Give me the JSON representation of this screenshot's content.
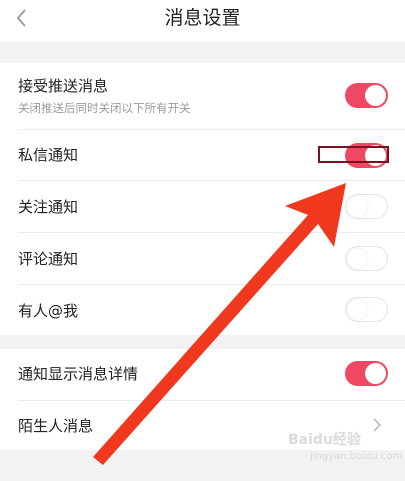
{
  "header": {
    "title": "消息设置",
    "back_icon": "chevron-left-icon"
  },
  "settings": {
    "push": {
      "label": "接受推送消息",
      "description": "关闭推送后同时关闭以下所有开关",
      "enabled": true
    },
    "private_message": {
      "label": "私信通知",
      "enabled": true
    },
    "follow": {
      "label": "关注通知",
      "enabled": false
    },
    "comment": {
      "label": "评论通知",
      "enabled": false
    },
    "mention": {
      "label": "有人@我",
      "enabled": false
    },
    "show_details": {
      "label": "通知显示消息详情",
      "enabled": true
    },
    "stranger": {
      "label": "陌生人消息",
      "icon": "chevron-right-icon"
    }
  },
  "overlay": {
    "arrow_color": "#f0381f",
    "highlight_color": "#7a1220"
  },
  "colors": {
    "toggle_on": "#ee4863",
    "background": "#f2f2f4"
  },
  "watermark": {
    "logo": "Baidu经验",
    "url": "jingyan.baidu.com"
  }
}
